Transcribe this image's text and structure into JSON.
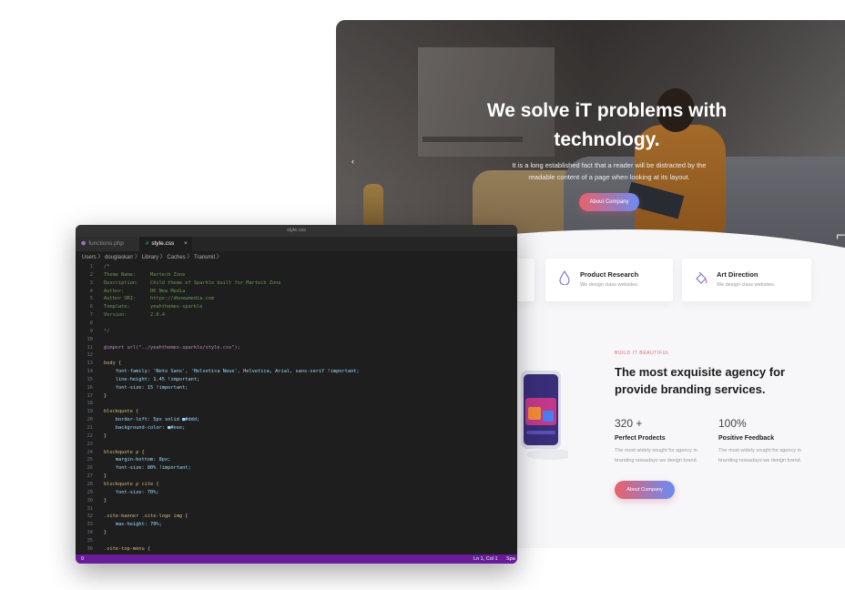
{
  "hero": {
    "title_line1": "We solve iT problems with",
    "title_line2": "technology.",
    "subtitle": "It is a long established fact that a reader will be distracted by the readable content of a page when looking at its layout.",
    "button": "About Company",
    "prev": "‹",
    "next": "⌐"
  },
  "cards": [
    {
      "title": "Product Research",
      "subtitle": "We design class websites.",
      "icon": "drop-icon"
    },
    {
      "title": "Art Direction",
      "subtitle": "We design class websites.",
      "icon": "paint-bucket-icon"
    }
  ],
  "about": {
    "tag": "BUILD IT BEAUTIFUL",
    "title": "The most exquisite agency for provide branding services.",
    "stats": [
      {
        "num": "320 +",
        "label": "Perfect Prodects",
        "desc": "The most widely sought for agency in branding nowadays we design brand."
      },
      {
        "num": "100%",
        "label": "Positive Feedback",
        "desc": "The most widely sought for agency in branding nowadays we design brand."
      }
    ],
    "button": "About Company"
  },
  "editor": {
    "window_title": "style.css",
    "tabs": [
      {
        "label": "functions.php",
        "icon": "php-file-icon"
      },
      {
        "label": "style.css",
        "icon": "css-file-icon",
        "close": "×"
      }
    ],
    "breadcrumb": "Users 〉 douglaskarr 〉 Library 〉 Caches 〉 Transmit 〉",
    "lines": [
      "/*",
      "Theme Name:     Martech Zone",
      "Description:    Child theme of Sparkle built for Martech Zone",
      "Author:         DK New Media",
      "Author URI:     https://dknewmedia.com",
      "Template:       yeahthemes-sparkle",
      "Version:        2.0.4",
      "",
      "*/",
      "",
      "@import url(\"../yeahthemes-sparkle/style.css\");",
      "",
      "body {",
      "    font-family: 'Noto Sans', 'Helvetica Neue', Helvetica, Arial, sans-serif !important;",
      "    line-height: 1.45 !important;",
      "    font-size: 15 !important;",
      "}",
      "",
      "blockquote {",
      "    border-left: 5px solid ■#ddd;",
      "    background-color: ■#eee;",
      "}",
      "",
      "blockquote p {",
      "    margin-bottom: 8px;",
      "    font-size: 80% !important;",
      "}",
      "blockquote p cite {",
      "    font-size: 70%;",
      "}",
      "",
      ".site-banner .site-logo img {",
      "    max-height: 70%;",
      "}",
      "",
      ".site-top-menu {"
    ],
    "status_left": "0",
    "status_position": "Ln 1, Col 1",
    "status_spaces": "Spa"
  },
  "colors": {
    "accent_start": "#e8616b",
    "accent_end": "#6c8bf3",
    "status_bar": "#6a1b9a"
  }
}
